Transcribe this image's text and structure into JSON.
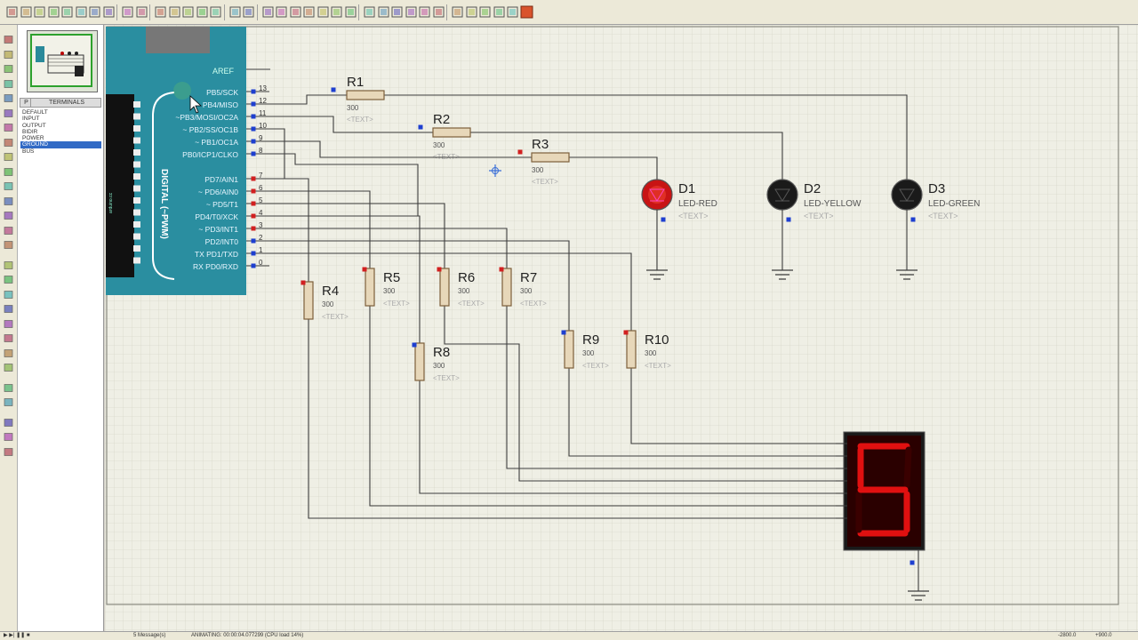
{
  "app": {
    "accent": "#b22222"
  },
  "toolbar": {
    "buttons": [
      "new-file-icon",
      "open-file-icon",
      "save-icon",
      "import-icon",
      "export-icon",
      "print-icon",
      "print-area-icon",
      "refresh-icon",
      "grid-icon",
      "origin-icon",
      "pan-icon",
      "zoom-in-icon",
      "zoom-out-icon",
      "zoom-all-icon",
      "zoom-area-icon",
      "undo-icon",
      "redo-icon",
      "cut-icon",
      "copy-icon",
      "paste-icon",
      "block-copy-icon",
      "block-move-icon",
      "block-rotate-icon",
      "block-delete-icon",
      "pick-device-icon",
      "make-device-icon",
      "packaging-icon",
      "decompose-icon",
      "wire-autorouter-icon",
      "search-tag-icon",
      "property-tool-icon",
      "new-sheet-icon",
      "remove-sheet-icon",
      "bill-of-materials-icon",
      "electrical-rules-icon",
      "netlist-to-ares-icon"
    ]
  },
  "left_tools": [
    "selection-mode-icon",
    "component-mode-icon",
    "junction-dot-icon",
    "wire-label-icon",
    "text-script-icon",
    "buses-icon",
    "subcircuit-icon",
    "terminals-mode-icon",
    "device-pins-icon",
    "graph-mode-icon",
    "tape-recorder-icon",
    "generator-mode-icon",
    "voltage-probe-icon",
    "current-probe-icon",
    "virtual-instruments-icon",
    "line-icon",
    "box-icon",
    "circle-icon",
    "arc-icon",
    "closed-path-icon",
    "text-icon",
    "symbol-icon",
    "marker-icon",
    "rotate-clockwise-icon",
    "rotate-anticlockwise-icon",
    "angle-field-icon",
    "mirror-x-icon",
    "mirror-y-icon"
  ],
  "terminals_panel": {
    "p_label": "P",
    "header": "TERMINALS",
    "items": [
      "DEFAULT",
      "INPUT",
      "OUTPUT",
      "BIDIR",
      "POWER",
      "GROUND",
      "BUS"
    ],
    "selected": "GROUND"
  },
  "arduino": {
    "side_label": "DIGITAL (~PWM)",
    "vertical_label": "arduino.cc",
    "aref_label": "AREF",
    "pins": [
      {
        "name": "PB5/SCK",
        "num": "13"
      },
      {
        "name": "PB4/MISO",
        "num": "12"
      },
      {
        "name": "~PB3/MOSI/OC2A",
        "num": "11"
      },
      {
        "name": "~ PB2/SS/OC1B",
        "num": "10"
      },
      {
        "name": "~ PB1/OC1A",
        "num": "9"
      },
      {
        "name": "PB0/ICP1/CLKO",
        "num": "8"
      },
      {
        "name": "PD7/AIN1",
        "num": "7"
      },
      {
        "name": "~ PD6/AIN0",
        "num": "6"
      },
      {
        "name": "~ PD5/T1",
        "num": "5"
      },
      {
        "name": "PD4/T0/XCK",
        "num": "4"
      },
      {
        "name": "~ PD3/INT1",
        "num": "3"
      },
      {
        "name": "PD2/INT0",
        "num": "2"
      },
      {
        "name": "TX PD1/TXD",
        "num": "1"
      },
      {
        "name": "RX PD0/RXD",
        "num": "0"
      }
    ]
  },
  "resistors": [
    {
      "ref": "R1",
      "value": "300",
      "text": "<TEXT>"
    },
    {
      "ref": "R2",
      "value": "300",
      "text": "<TEXT>"
    },
    {
      "ref": "R3",
      "value": "300",
      "text": "<TEXT>"
    },
    {
      "ref": "R4",
      "value": "300",
      "text": "<TEXT>"
    },
    {
      "ref": "R5",
      "value": "300",
      "text": "<TEXT>"
    },
    {
      "ref": "R6",
      "value": "300",
      "text": "<TEXT>"
    },
    {
      "ref": "R7",
      "value": "300",
      "text": "<TEXT>"
    },
    {
      "ref": "R8",
      "value": "300",
      "text": "<TEXT>"
    },
    {
      "ref": "R9",
      "value": "300",
      "text": "<TEXT>"
    },
    {
      "ref": "R10",
      "value": "300",
      "text": "<TEXT>"
    }
  ],
  "leds": [
    {
      "ref": "D1",
      "type": "LED-RED",
      "text": "<TEXT>",
      "color": "#c81414"
    },
    {
      "ref": "D2",
      "type": "LED-YELLOW",
      "text": "<TEXT>",
      "color": "#1a1a1a"
    },
    {
      "ref": "D3",
      "type": "LED-GREEN",
      "text": "<TEXT>",
      "color": "#1a1a1a"
    }
  ],
  "seven_segment": {
    "digit": "5",
    "on_color": "#e01010",
    "off_color": "#3a0000"
  },
  "statusbar": {
    "sheet": "5 Message(s)",
    "info": "ANIMATING: 00:00:04.077299 (CPU load 14%)",
    "coords": "-2800.0",
    "coords2": "+900.0"
  }
}
